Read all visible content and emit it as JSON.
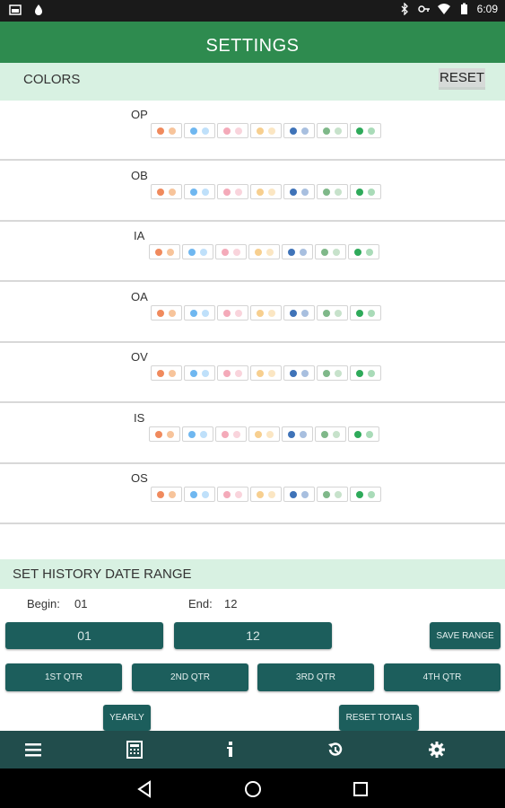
{
  "status_bar": {
    "time": "6:09",
    "left_icons": [
      "image-icon",
      "drop-icon"
    ],
    "right_icons": [
      "bluetooth-icon",
      "key-icon",
      "wifi-icon",
      "battery-icon"
    ]
  },
  "app_bar": {
    "title": "SETTINGS"
  },
  "colors_section": {
    "label": "COLORS",
    "reset_label": "RESET",
    "rows": [
      {
        "label": "OP"
      },
      {
        "label": "OB"
      },
      {
        "label": "IA"
      },
      {
        "label": "OA"
      },
      {
        "label": "OV"
      },
      {
        "label": "IS"
      },
      {
        "label": "OS"
      }
    ],
    "swatch_colors": [
      [
        "#f08a5d",
        "#f7c49b"
      ],
      [
        "#6fb7f0",
        "#bfe0fa"
      ],
      [
        "#f4aab9",
        "#f9d4dc"
      ],
      [
        "#f7cf8f",
        "#fbe6c3"
      ],
      [
        "#3f73b8",
        "#a8bfdf"
      ],
      [
        "#7fb889",
        "#c7e2cb"
      ],
      [
        "#2eaa5a",
        "#a9dbb8"
      ]
    ]
  },
  "history_section": {
    "label": "SET HISTORY DATE RANGE",
    "begin_label": "Begin:",
    "begin_value": "01",
    "end_label": "End:",
    "end_value": "12",
    "begin_field": "01",
    "end_field": "12",
    "save_range_label": "SAVE RANGE",
    "quarters": [
      "1ST QTR",
      "2ND QTR",
      "3RD QTR",
      "4TH QTR"
    ],
    "yearly_label": "YEARLY",
    "reset_totals_label": "RESET TOTALS"
  },
  "bottom_nav": {
    "items": [
      "menu-icon",
      "calculator-icon",
      "info-icon",
      "history-icon",
      "settings-gear-icon"
    ]
  },
  "system_nav": {
    "items": [
      "back-icon",
      "home-icon",
      "recents-icon"
    ]
  },
  "colors": {
    "app_bar": "#2e8b4f",
    "section_header": "#d8f1e2",
    "teal_button": "#1c5e5c",
    "bottom_nav": "#214d4c"
  }
}
